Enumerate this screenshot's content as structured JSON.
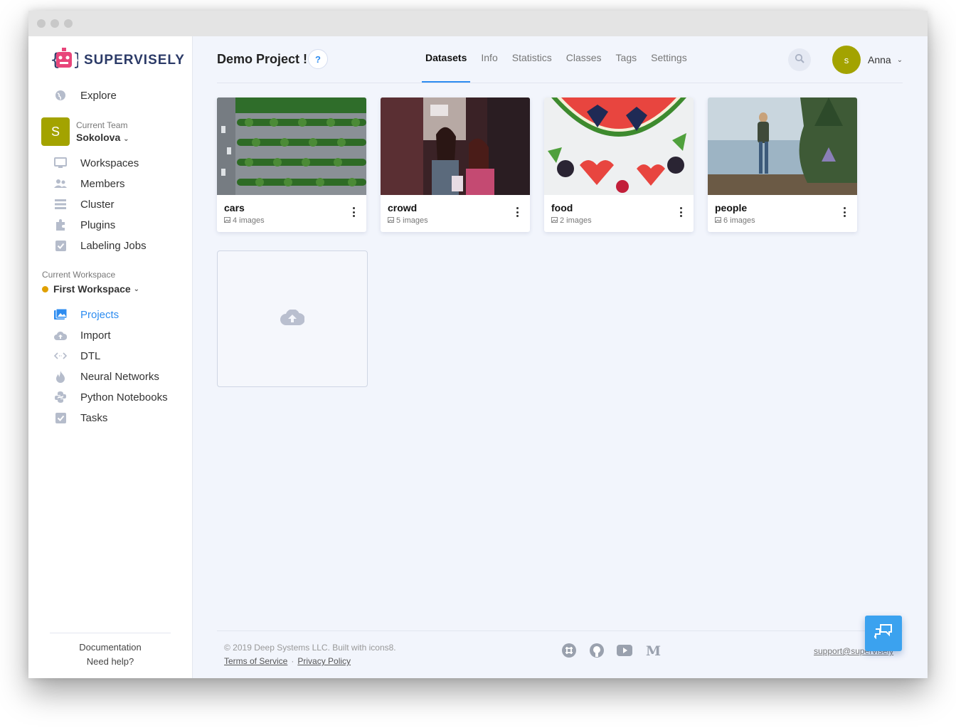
{
  "brand": {
    "name": "SUPERVISELY"
  },
  "sidebar": {
    "explore": "Explore",
    "team": {
      "label": "Current Team",
      "name": "Sokolova",
      "initial": "S"
    },
    "team_items": [
      {
        "label": "Workspaces",
        "icon": "monitor-icon"
      },
      {
        "label": "Members",
        "icon": "people-icon"
      },
      {
        "label": "Cluster",
        "icon": "server-list-icon"
      },
      {
        "label": "Plugins",
        "icon": "puzzle-icon"
      },
      {
        "label": "Labeling Jobs",
        "icon": "check-square-icon"
      }
    ],
    "workspace": {
      "label": "Current Workspace",
      "name": "First Workspace",
      "status_color": "#e0a000"
    },
    "workspace_items": [
      {
        "label": "Projects",
        "icon": "images-icon",
        "active": true
      },
      {
        "label": "Import",
        "icon": "cloud-upload-icon"
      },
      {
        "label": "DTL",
        "icon": "code-arrows-icon"
      },
      {
        "label": "Neural Networks",
        "icon": "flame-icon"
      },
      {
        "label": "Python Notebooks",
        "icon": "python-icon"
      },
      {
        "label": "Tasks",
        "icon": "check-square-icon"
      }
    ],
    "footer": {
      "documentation": "Documentation",
      "help": "Need help?"
    }
  },
  "header": {
    "project_title": "Demo Project !",
    "help_label": "?",
    "tabs": [
      {
        "label": "Datasets",
        "active": true
      },
      {
        "label": "Info"
      },
      {
        "label": "Statistics"
      },
      {
        "label": "Classes"
      },
      {
        "label": "Tags"
      },
      {
        "label": "Settings"
      }
    ],
    "user": {
      "name": "Anna",
      "initial": "s"
    }
  },
  "datasets": [
    {
      "name": "cars",
      "count": "4 images",
      "thumb": "aerial-parking-lot"
    },
    {
      "name": "crowd",
      "count": "5 images",
      "thumb": "two-women-street"
    },
    {
      "name": "food",
      "count": "2 images",
      "thumb": "watermelon-berries"
    },
    {
      "name": "people",
      "count": "6 images",
      "thumb": "person-lakeside"
    }
  ],
  "footer": {
    "copyright": "© 2019 Deep Systems LLC. Built with icons8.",
    "terms": "Terms of Service",
    "privacy": "Privacy Policy",
    "support": "support@supervisely",
    "social": [
      "slack-icon",
      "github-icon",
      "youtube-icon",
      "medium-icon"
    ]
  },
  "colors": {
    "accent": "#2d8cf0",
    "avatar": "#a3a300",
    "chat_button": "#3ba2ef",
    "brand_text": "#2b3a67",
    "logo_pink": "#e8457a"
  }
}
